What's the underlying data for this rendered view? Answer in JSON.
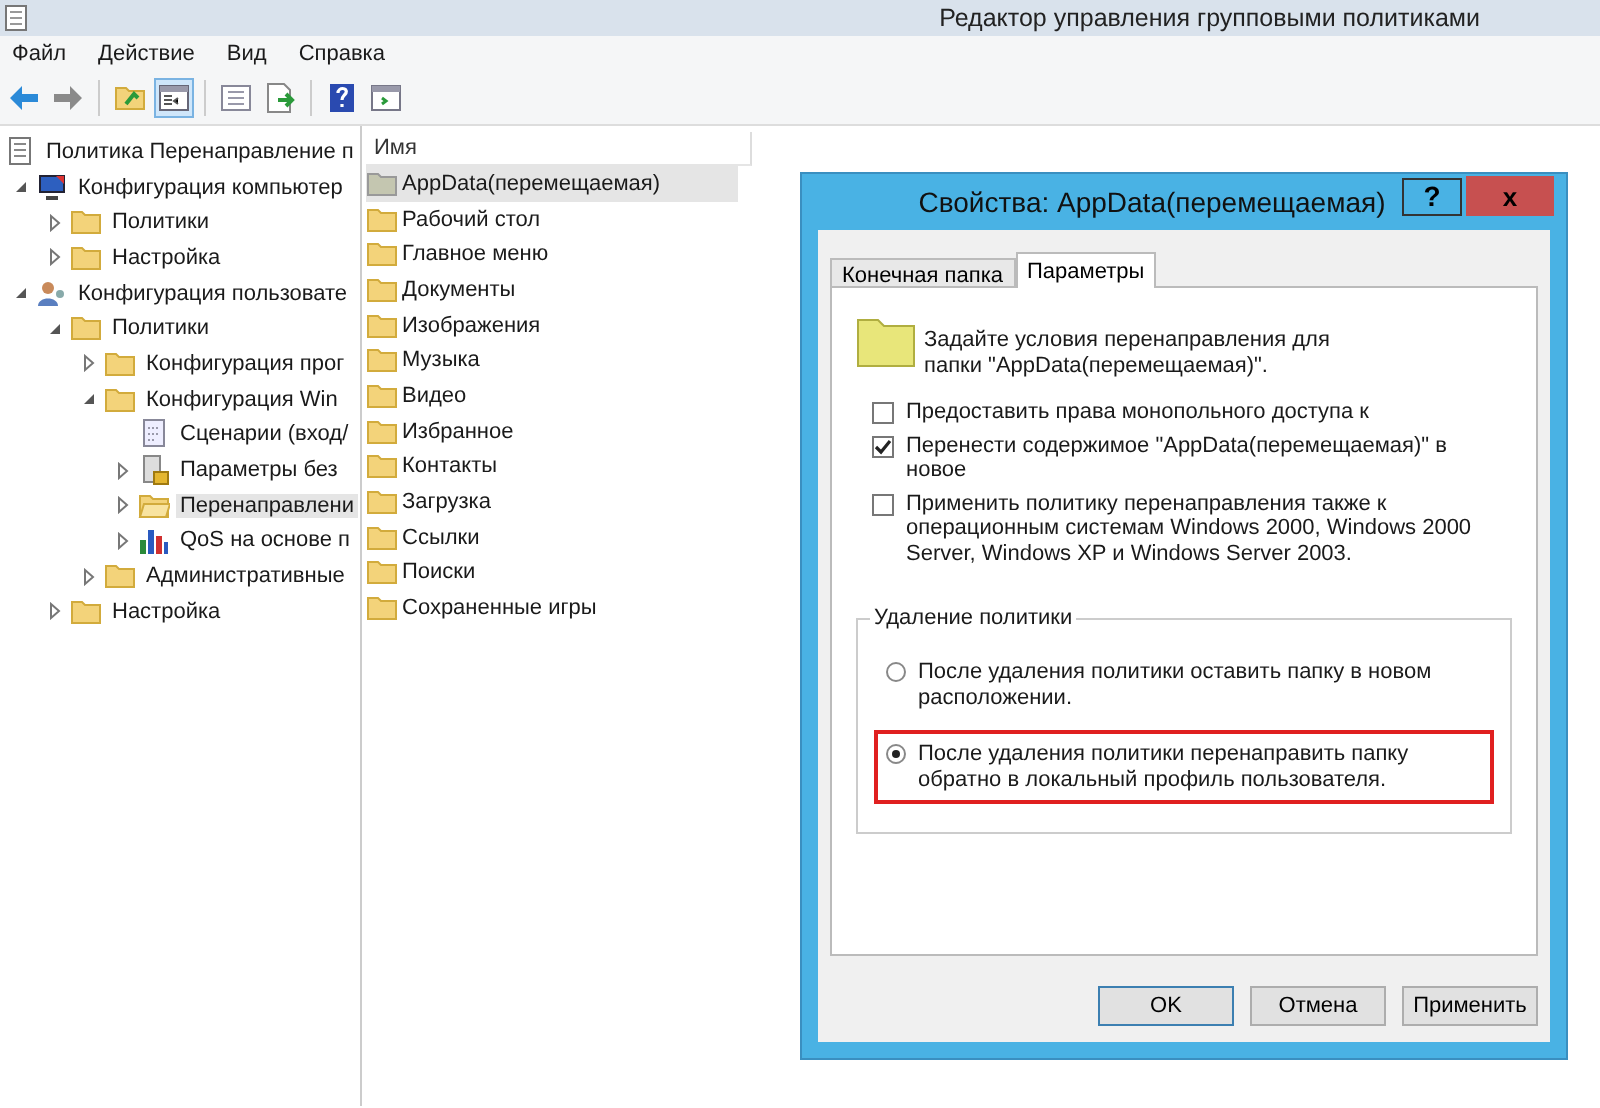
{
  "window": {
    "title": "Редактор управления групповыми политиками"
  },
  "menu": [
    "Файл",
    "Действие",
    "Вид",
    "Справка"
  ],
  "toolbar": [
    {
      "kind": "back",
      "selected": false
    },
    {
      "kind": "forward",
      "selected": false
    },
    {
      "kind": "up",
      "selected": false
    },
    {
      "kind": "pane",
      "selected": true
    },
    {
      "kind": "list",
      "selected": false
    },
    {
      "kind": "export",
      "selected": false
    },
    {
      "kind": "help",
      "selected": false
    },
    {
      "kind": "view",
      "selected": false
    }
  ],
  "tree": [
    {
      "label": "Политика Перенаправление п",
      "kind": "doc",
      "selected": false,
      "children": [
        {
          "label": "Конфигурация компьютер",
          "kind": "computer",
          "expanded": true,
          "selected": false,
          "children": [
            {
              "label": "Политики",
              "kind": "folder",
              "expanded": false,
              "selected": false
            },
            {
              "label": "Настройка",
              "kind": "folder",
              "expanded": false,
              "selected": false
            }
          ]
        },
        {
          "label": "Конфигурация пользовате",
          "kind": "user",
          "expanded": true,
          "selected": false,
          "children": [
            {
              "label": "Политики",
              "kind": "folder",
              "expanded": true,
              "selected": false,
              "children": [
                {
                  "label": "Конфигурация прог",
                  "kind": "folder",
                  "expanded": false,
                  "selected": false
                },
                {
                  "label": "Конфигурация Win",
                  "kind": "folder",
                  "expanded": true,
                  "selected": false,
                  "children": [
                    {
                      "label": "Сценарии (вход/",
                      "kind": "script",
                      "selected": false
                    },
                    {
                      "label": "Параметры без",
                      "kind": "security",
                      "expanded": false,
                      "selected": false
                    },
                    {
                      "label": "Перенаправлени",
                      "kind": "folder-open",
                      "expanded": false,
                      "selected": true
                    },
                    {
                      "label": "QoS на основе п",
                      "kind": "chart",
                      "expanded": false,
                      "selected": false
                    }
                  ]
                },
                {
                  "label": "Административные",
                  "kind": "folder",
                  "expanded": false,
                  "selected": false
                }
              ]
            },
            {
              "label": "Настройка",
              "kind": "folder",
              "expanded": false,
              "selected": false
            }
          ]
        }
      ]
    }
  ],
  "list": {
    "column": "Имя",
    "items": [
      {
        "label": "AppData(перемещаемая)",
        "selected": true
      },
      {
        "label": "Рабочий стол",
        "selected": false
      },
      {
        "label": "Главное меню",
        "selected": false
      },
      {
        "label": "Документы",
        "selected": false
      },
      {
        "label": "Изображения",
        "selected": false
      },
      {
        "label": "Музыка",
        "selected": false
      },
      {
        "label": "Видео",
        "selected": false
      },
      {
        "label": "Избранное",
        "selected": false
      },
      {
        "label": "Контакты",
        "selected": false
      },
      {
        "label": "Загрузка",
        "selected": false
      },
      {
        "label": "Ссылки",
        "selected": false
      },
      {
        "label": "Поиски",
        "selected": false
      },
      {
        "label": "Сохраненные игры",
        "selected": false
      }
    ]
  },
  "dialog": {
    "title": "Свойства: AppData(перемещаемая)",
    "help": "?",
    "close": "x",
    "tabs": [
      {
        "label": "Конечная папка",
        "selected": false
      },
      {
        "label": "Параметры",
        "selected": true
      }
    ],
    "description": "Задайте условия перенаправления для папки \"AppData(перемещаемая)\".",
    "options": [
      {
        "label": "Предоставить права монопольного доступа к",
        "checked": false
      },
      {
        "label": "Перенести содержимое \"AppData(перемещаемая)\" в новое",
        "checked": true
      },
      {
        "label": "Применить политику перенаправления также к операционным системам Windows 2000, Windows 2000 Server, Windows XP и Windows Server 2003.",
        "checked": false
      }
    ],
    "group": {
      "title": "Удаление политики",
      "radios": [
        {
          "label": "После удаления политики оставить папку в новом расположении.",
          "selected": false,
          "highlighted": false
        },
        {
          "label": "После удаления политики перенаправить папку обратно в локальный профиль пользователя.",
          "selected": true,
          "highlighted": true
        }
      ]
    },
    "buttons": [
      {
        "label": "OK",
        "default": true
      },
      {
        "label": "Отмена",
        "default": false
      },
      {
        "label": "Применить",
        "default": false
      }
    ]
  }
}
